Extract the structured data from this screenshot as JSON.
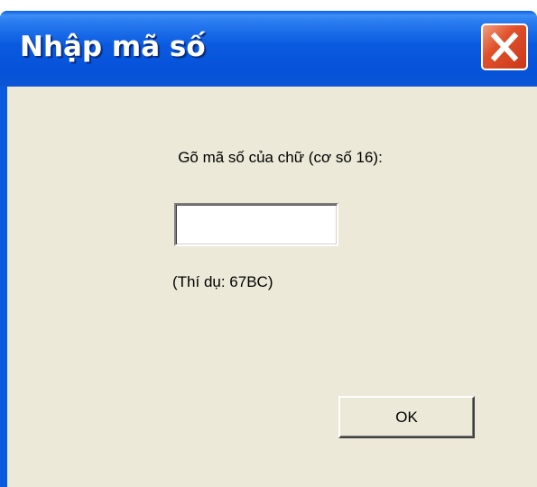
{
  "window": {
    "title": "Nhập mã số",
    "close_icon": "close-icon"
  },
  "dialog": {
    "prompt": "Gõ mã số của chữ (cơ số 16):",
    "code_input": {
      "value": "",
      "placeholder": ""
    },
    "example": "(Thí dụ: 67BC)",
    "ok_label": "OK"
  },
  "colors": {
    "titlebar": "#0a5ae0",
    "close_button": "#e0502a",
    "client_background": "#ece9d8"
  }
}
